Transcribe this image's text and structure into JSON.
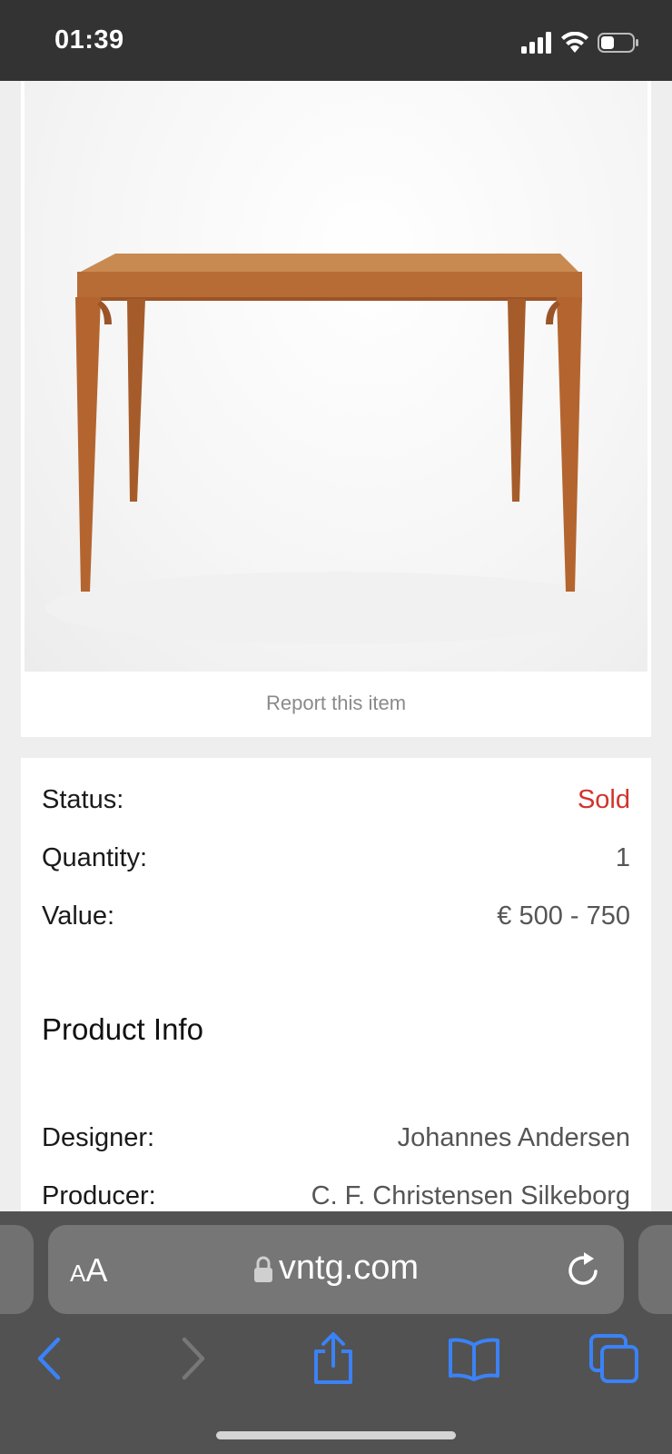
{
  "status_bar": {
    "time": "01:39",
    "icons": [
      "signal-icon",
      "wifi-icon",
      "battery-icon"
    ]
  },
  "product": {
    "image_alt": "teak side table",
    "report_label": "Report this item"
  },
  "details": {
    "rows": [
      {
        "label": "Status:",
        "value": "Sold",
        "value_color": "#d0342c"
      },
      {
        "label": "Quantity:",
        "value": "1"
      },
      {
        "label": "Value:",
        "value": "€ 500 - 750"
      }
    ],
    "section_title": "Product Info",
    "info_rows": [
      {
        "label": "Designer:",
        "value": "Johannes Andersen"
      },
      {
        "label": "Producer:",
        "value": "C. F. Christensen Silkeborg"
      }
    ]
  },
  "browser": {
    "aa_label_small": "A",
    "aa_label_large": "A",
    "url": "vntg.com",
    "toolbar_icons": [
      "back-icon",
      "forward-icon",
      "share-icon",
      "bookmarks-icon",
      "tabs-icon"
    ]
  },
  "colors": {
    "accent": "#3b82f6",
    "sold": "#d0342c",
    "status_bar_bg": "#333333",
    "browser_bg": "#525252"
  }
}
